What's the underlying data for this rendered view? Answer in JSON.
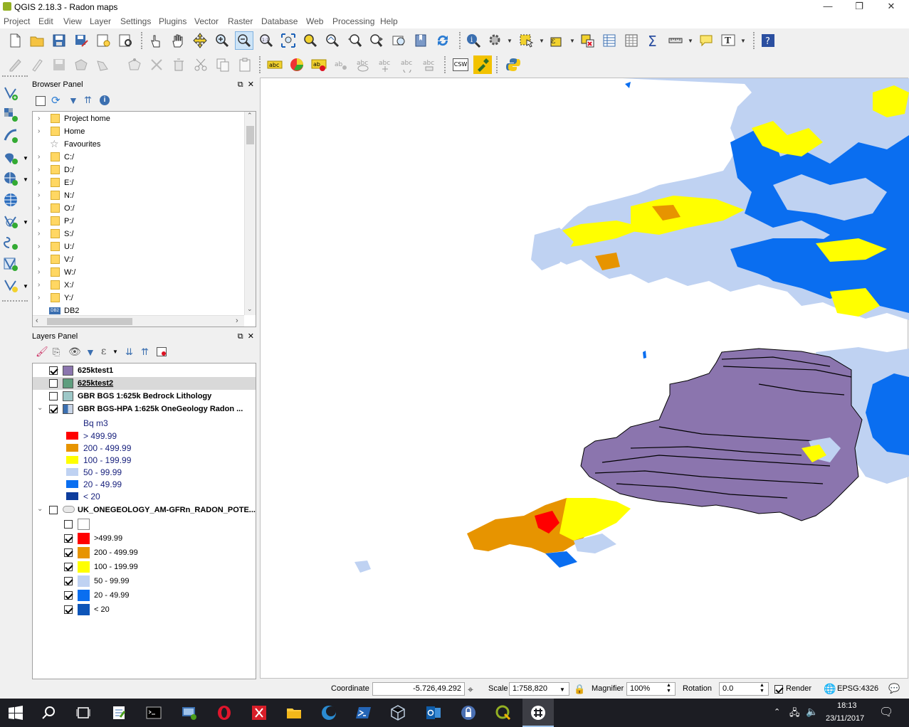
{
  "window": {
    "title": "QGIS 2.18.3 - Radon maps",
    "minimize": "—",
    "maximize": "❐",
    "close": "✕"
  },
  "menu": [
    "Project",
    "Edit",
    "View",
    "Layer",
    "Settings",
    "Plugins",
    "Vector",
    "Raster",
    "Database",
    "Web",
    "Processing",
    "Help"
  ],
  "toolbar2": {
    "csw_label": "CSW"
  },
  "browser": {
    "title": "Browser Panel",
    "items": [
      {
        "label": "Project home",
        "icon": "folder"
      },
      {
        "label": "Home",
        "icon": "folder"
      },
      {
        "label": "Favourites",
        "icon": "star"
      },
      {
        "label": "C:/",
        "icon": "folder"
      },
      {
        "label": "D:/",
        "icon": "folder"
      },
      {
        "label": "E:/",
        "icon": "folder"
      },
      {
        "label": "N:/",
        "icon": "folder"
      },
      {
        "label": "O:/",
        "icon": "folder"
      },
      {
        "label": "P:/",
        "icon": "folder"
      },
      {
        "label": "S:/",
        "icon": "folder"
      },
      {
        "label": "U:/",
        "icon": "folder"
      },
      {
        "label": "V:/",
        "icon": "folder"
      },
      {
        "label": "W:/",
        "icon": "folder"
      },
      {
        "label": "X:/",
        "icon": "folder"
      },
      {
        "label": "Y:/",
        "icon": "folder"
      },
      {
        "label": "DB2",
        "icon": "db2"
      }
    ]
  },
  "layers": {
    "title": "Layers Panel",
    "rows": [
      {
        "label": "625ktest1",
        "checked": true,
        "color": "#8b75ae",
        "bold": true
      },
      {
        "label": "625ktest2",
        "checked": false,
        "color": "#5e9e7e",
        "bold": true,
        "selected": true
      },
      {
        "label": "GBR BGS 1:625k Bedrock Lithology",
        "checked": false,
        "color": "#9ec8c8",
        "bold": true
      },
      {
        "label": "GBR BGS-HPA 1:625k OneGeology Radon ...",
        "checked": true,
        "color": "raster",
        "bold": true,
        "expanded": true
      }
    ],
    "radon_unit": "Bq m3",
    "radon_legend": [
      {
        "label": "> 499.99",
        "color": "#ff0000"
      },
      {
        "label": "200 - 499.99",
        "color": "#e79400"
      },
      {
        "label": "100 - 199.99",
        "color": "#ffff00"
      },
      {
        "label": "50 - 99.99",
        "color": "#bfd2f2"
      },
      {
        "label": "20 - 49.99",
        "color": "#0a6ef0"
      },
      {
        "label": "< 20",
        "color": "#0d3c9c"
      }
    ],
    "wms_layer": {
      "label": "UK_ONEGEOLOGY_AM-GFRn_RADON_POTE...",
      "checked": false
    },
    "wms_legend": [
      {
        "label": "",
        "color": "#ffffff"
      },
      {
        "label": ">499.99",
        "color": "#ff0000"
      },
      {
        "label": "200 - 499.99",
        "color": "#e79400"
      },
      {
        "label": "100 - 199.99",
        "color": "#ffff00"
      },
      {
        "label": "50 - 99.99",
        "color": "#bfd2f2"
      },
      {
        "label": "20 - 49.99",
        "color": "#0a6ef0"
      },
      {
        "label": "< 20",
        "color": "#0d55b8"
      }
    ]
  },
  "status": {
    "coordinate_label": "Coordinate",
    "coordinate": "-5.726,49.292",
    "scale_label": "Scale",
    "scale": "1:758,820",
    "magnifier_label": "Magnifier",
    "magnifier": "100%",
    "rotation_label": "Rotation",
    "rotation": "0.0",
    "render_label": "Render",
    "render_checked": true,
    "crs": "EPSG:4326"
  },
  "taskbar": {
    "time": "18:13",
    "date": "23/11/2017"
  },
  "colors": {
    "purple": "#8b75ae",
    "light_blue": "#bfd2f2",
    "blue": "#0a6ef0",
    "yellow": "#ffff00",
    "orange": "#e79400",
    "red": "#ff0000",
    "dark_blue": "#0d3c9c"
  }
}
